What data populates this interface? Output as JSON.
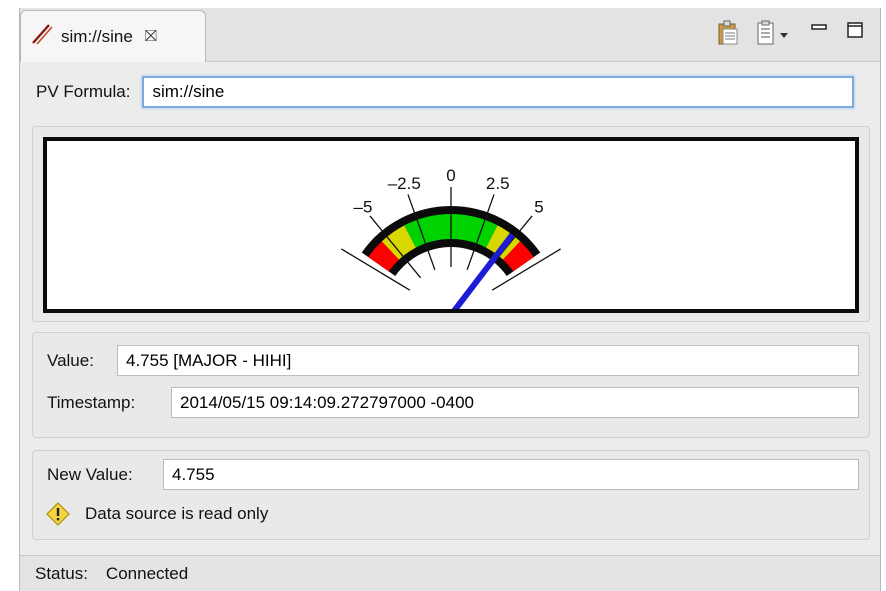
{
  "tab": {
    "title": "sim://sine",
    "close_glyph": "⛝"
  },
  "formula": {
    "label": "PV Formula:",
    "value": "sim://sine"
  },
  "gauge": {
    "ticks": [
      {
        "value": -5,
        "label": "–5"
      },
      {
        "value": -2.5,
        "label": "–2.5"
      },
      {
        "value": 0,
        "label": "0"
      },
      {
        "value": 2.5,
        "label": "2.5"
      },
      {
        "value": 5,
        "label": "5"
      }
    ],
    "minor_ticks": [
      -7.5,
      -5,
      -2.5,
      0,
      2.5,
      5,
      7.5
    ],
    "range": [
      -7,
      7
    ],
    "zones": [
      {
        "from": -7,
        "to": -5.5,
        "color": "#ff0000"
      },
      {
        "from": -5.5,
        "to": -3.5,
        "color": "#d8d800"
      },
      {
        "from": -3.5,
        "to": 3.5,
        "color": "#00d200"
      },
      {
        "from": 3.5,
        "to": 5.5,
        "color": "#d8d800"
      },
      {
        "from": 5.5,
        "to": 7,
        "color": "#ff0000"
      }
    ],
    "needle_value": 4.755,
    "needle_color": "#1c1cd6"
  },
  "info": {
    "value_label": "Value:",
    "value_text": "4.755 [MAJOR - HIHI]",
    "timestamp_label": "Timestamp:",
    "timestamp_text": "2014/05/15 09:14:09.272797000 -0400"
  },
  "write": {
    "new_value_label": "New Value:",
    "new_value": "4.755",
    "warning_text": "Data source is read only"
  },
  "status": {
    "label": "Status:",
    "value": "Connected"
  }
}
